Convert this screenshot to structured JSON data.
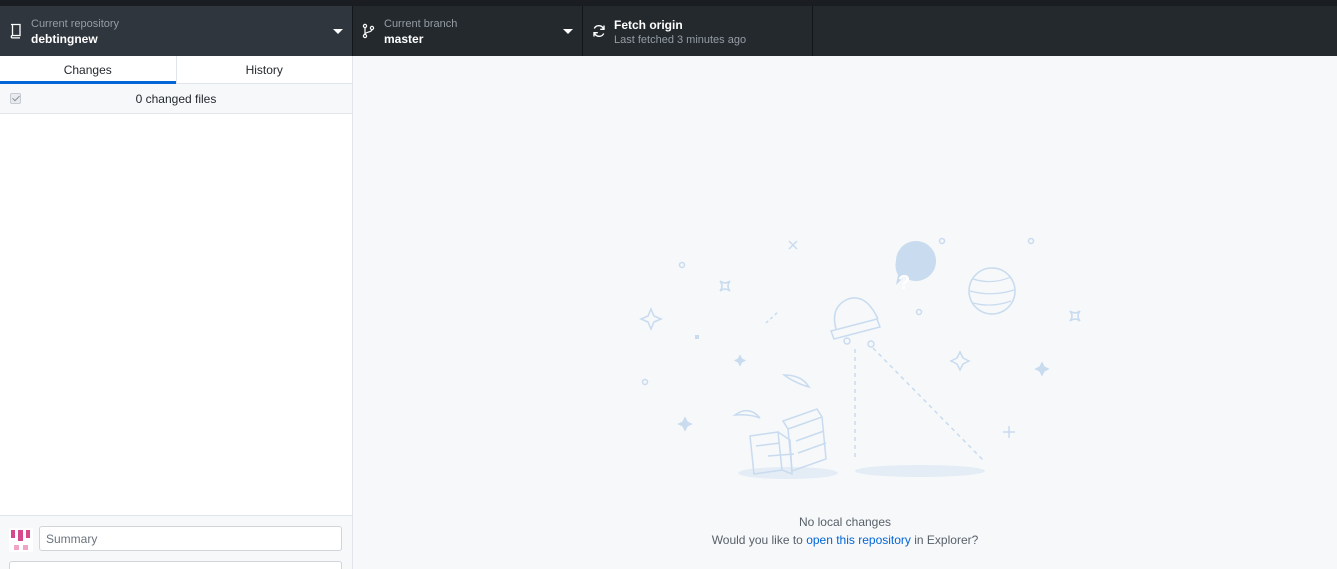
{
  "toolbar": {
    "repository": {
      "label": "Current repository",
      "value": "debtingnew"
    },
    "branch": {
      "label": "Current branch",
      "value": "master"
    },
    "fetch": {
      "label": "Fetch origin",
      "status": "Last fetched 3 minutes ago"
    }
  },
  "sidebar": {
    "tabs": [
      {
        "label": "Changes",
        "selected": true
      },
      {
        "label": "History",
        "selected": false
      }
    ],
    "changed_files": "0 changed files",
    "commit": {
      "summary_placeholder": "Summary"
    }
  },
  "main": {
    "blank_title": "No local changes",
    "blank_prefix": "Would you like to ",
    "blank_link": "open this repository",
    "blank_suffix": " in Explorer?"
  },
  "colors": {
    "accent": "#0366d6",
    "toolbar": "#24292e",
    "illustration": "#c8dbef"
  }
}
